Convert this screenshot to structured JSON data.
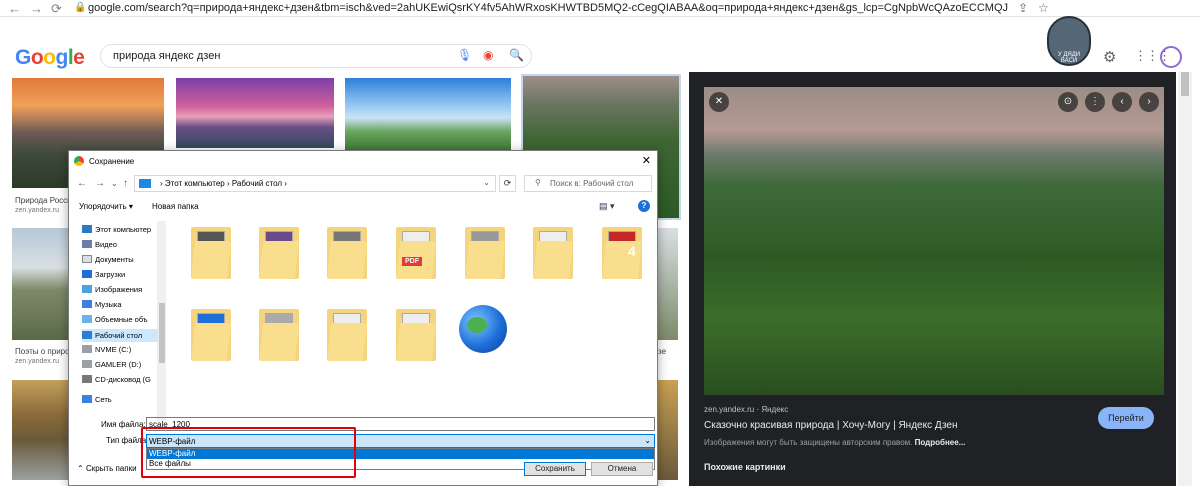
{
  "browser": {
    "url": "google.com/search?q=природа+яндекс+дзен&tbm=isch&ved=2ahUKEwiQsrKY4fv5AhWRxosKHWTBD5MQ2-cCegQIABAA&oq=природа+яндекс+дзен&gs_lcp=CgNpbWcQAzoECCMQJzoECAAQGDoLCAAQgAQQsQMQgwE6CAgAEIAE..."
  },
  "google": {
    "logo": [
      "G",
      "o",
      "o",
      "g",
      "l",
      "e"
    ],
    "query": "природа яндекс дзен"
  },
  "results": [
    {
      "caption": "Природа Росси",
      "source": "zen.yandex.ru"
    },
    {
      "caption": "Поэты о приро",
      "source": "zen.yandex.ru"
    }
  ],
  "extra_caption_suffix": "зе",
  "side_panel": {
    "source": "zen.yandex.ru · Яндекс",
    "title": "Сказочно красивая природа | Хочу-Могу | Яндекс Дзен",
    "copyright": "Изображения могут быть защищены авторским правом.",
    "more": "Подробнее...",
    "goto": "Перейти",
    "similar": "Похожие картинки"
  },
  "avatar_text": "У ДЯДИ ВАСИ",
  "dialog": {
    "title": "Сохранение",
    "path": [
      "Этот компьютер",
      "Рабочий стол"
    ],
    "search_placeholder": "Поиск в: Рабочий стол",
    "organize": "Упорядочить",
    "new_folder": "Новая папка",
    "tree": [
      {
        "label": "Этот компьютер",
        "icon": "computer-icon"
      },
      {
        "label": "Видео",
        "icon": "video-icon"
      },
      {
        "label": "Документы",
        "icon": "documents-icon"
      },
      {
        "label": "Загрузки",
        "icon": "download-icon"
      },
      {
        "label": "Изображения",
        "icon": "images-icon"
      },
      {
        "label": "Музыка",
        "icon": "music-icon"
      },
      {
        "label": "Объемные объ",
        "icon": "3d-objects-icon"
      },
      {
        "label": "Рабочий стол",
        "icon": "desktop-icon"
      },
      {
        "label": "NVME (C:)",
        "icon": "drive-icon"
      },
      {
        "label": "GAMLER (D:)",
        "icon": "drive-icon"
      },
      {
        "label": "CD-дисковод (G",
        "icon": "cd-drive-icon"
      },
      {
        "label": "Сеть",
        "icon": "network-icon"
      }
    ],
    "filename_label": "Имя файла:",
    "filename": "scale_1200",
    "filetype_label": "Тип файла:",
    "filetype": "WEBP-файл",
    "filetype_options": [
      "WEBP-файл",
      "Все файлы"
    ],
    "hide_folders": "Скрыть папки",
    "save": "Сохранить",
    "cancel": "Отмена",
    "pdf_label": "PDF",
    "num_label": "4"
  },
  "colors": {
    "accent": "#1a73e8",
    "highlight": "#e0000b",
    "dark_panel": "#202124"
  }
}
